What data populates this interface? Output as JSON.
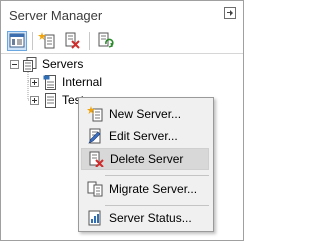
{
  "window": {
    "title": "Server Manager"
  },
  "toolbar": {
    "buttons": [
      {
        "icon": "server-view-icon",
        "active": true
      },
      {
        "icon": "new-server-icon"
      },
      {
        "icon": "delete-server-icon"
      },
      {
        "icon": "refresh-icon"
      }
    ]
  },
  "tree": {
    "root": "Servers",
    "children": [
      "Internal",
      "Test"
    ]
  },
  "context_menu": {
    "items": {
      "new_server": "New Server...",
      "edit_server": "Edit Server...",
      "delete_server": "Delete Server",
      "migrate_server": "Migrate Server...",
      "server_status": "Server Status..."
    }
  },
  "colors": {
    "accent": "#cfe4f8",
    "delete_red": "#d12b2b",
    "new_star": "#f0a30a",
    "refresh_green": "#2a8a2a"
  }
}
